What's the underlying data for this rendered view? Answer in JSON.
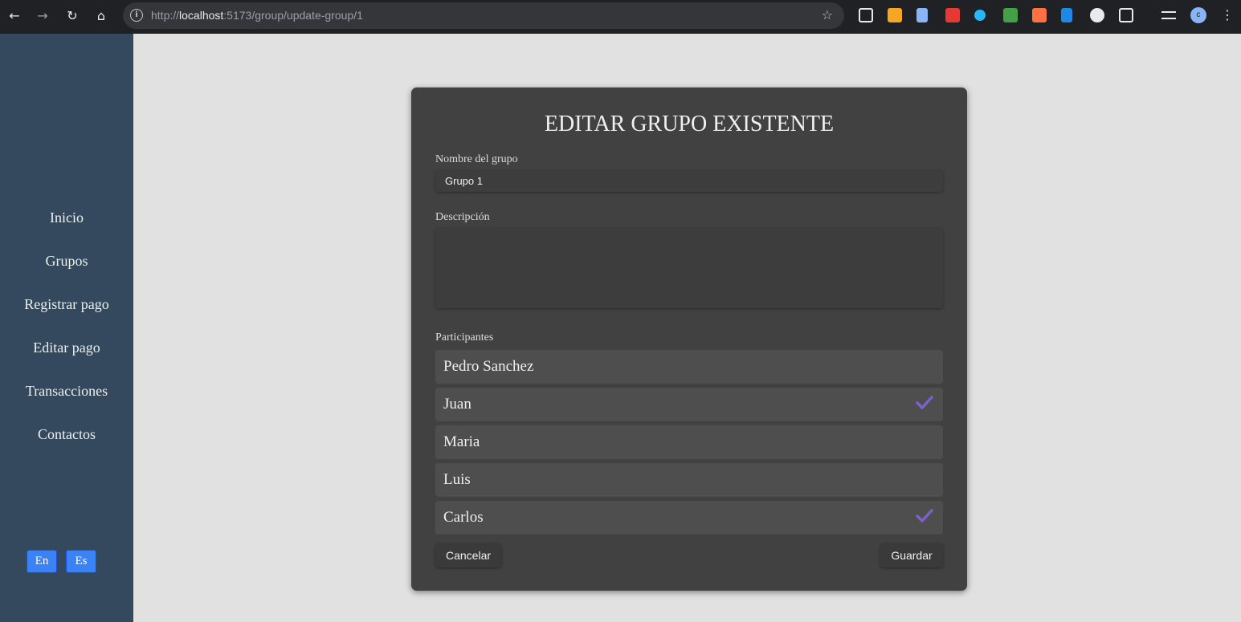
{
  "browser": {
    "url_scheme": "http://",
    "url_host": "localhost",
    "url_path": ":5173/group/update-group/1",
    "profile_initial": "c"
  },
  "sidebar": {
    "items": [
      {
        "label": "Inicio"
      },
      {
        "label": "Grupos"
      },
      {
        "label": "Registrar pago"
      },
      {
        "label": "Editar pago"
      },
      {
        "label": "Transacciones"
      },
      {
        "label": "Contactos"
      }
    ],
    "lang": {
      "en": "En",
      "es": "Es"
    }
  },
  "form": {
    "title": "EDITAR GRUPO EXISTENTE",
    "name_label": "Nombre del grupo",
    "name_value": "Grupo 1",
    "description_label": "Descripción",
    "description_value": "",
    "participants_label": "Participantes",
    "participants": [
      {
        "name": "Pedro Sanchez",
        "selected": false
      },
      {
        "name": "Juan",
        "selected": true
      },
      {
        "name": "Maria",
        "selected": false
      },
      {
        "name": "Luis",
        "selected": false
      },
      {
        "name": "Carlos",
        "selected": true
      }
    ],
    "cancel_label": "Cancelar",
    "save_label": "Guardar"
  },
  "colors": {
    "sidebar": "#34495e",
    "card": "#414141",
    "check": "#7b61c9",
    "lang_button": "#3b82f6"
  }
}
